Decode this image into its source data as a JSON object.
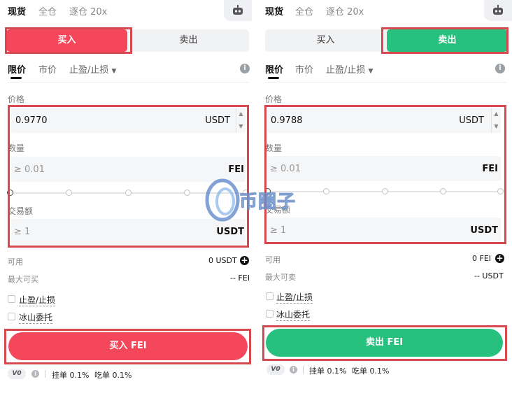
{
  "colors": {
    "buy": "#f5475b",
    "sell": "#28c07f",
    "highlight": "#d64a4f"
  },
  "buy_panel": {
    "modes": [
      "现货",
      "全仓",
      "逐仓 20x"
    ],
    "robot_icon": "robot-icon",
    "side_tabs": {
      "buy": "买入",
      "sell": "卖出"
    },
    "order_types": {
      "limit": "限价",
      "market": "市价",
      "tpsl": "止盈/止损"
    },
    "price": {
      "label": "价格",
      "value": "0.9770",
      "unit": "USDT"
    },
    "amount": {
      "label": "数量",
      "placeholder": "≥ 0.01",
      "unit": "FEI"
    },
    "total": {
      "label": "交易额",
      "placeholder": "≥ 1",
      "unit": "USDT"
    },
    "available": {
      "label": "可用",
      "value": "0 USDT"
    },
    "max": {
      "label": "最大可买",
      "value": "-- FEI"
    },
    "checkboxes": [
      "止盈/止损",
      "冰山委托"
    ],
    "submit": "买入 FEI",
    "fee": {
      "vip": "V0",
      "maker": "挂单 0.1%",
      "taker": "吃单 0.1%"
    }
  },
  "sell_panel": {
    "modes": [
      "现货",
      "全仓",
      "逐仓 20x"
    ],
    "robot_icon": "robot-icon",
    "side_tabs": {
      "buy": "买入",
      "sell": "卖出"
    },
    "order_types": {
      "limit": "限价",
      "market": "市价",
      "tpsl": "止盈/止损"
    },
    "price": {
      "label": "价格",
      "value": "0.9788",
      "unit": "USDT"
    },
    "amount": {
      "label": "数量",
      "placeholder": "≥ 0.01",
      "unit": "FEI"
    },
    "total": {
      "label": "交易额",
      "placeholder": "≥ 1",
      "unit": "USDT"
    },
    "available": {
      "label": "可用",
      "value": "0 FEI"
    },
    "max": {
      "label": "最大可卖",
      "value": "-- USDT"
    },
    "checkboxes": [
      "止盈/止损",
      "冰山委托"
    ],
    "submit": "卖出 FEI",
    "fee": {
      "vip": "V0",
      "maker": "挂单 0.1%",
      "taker": "吃单 0.1%"
    }
  },
  "watermark": {
    "text": "币圈子"
  }
}
